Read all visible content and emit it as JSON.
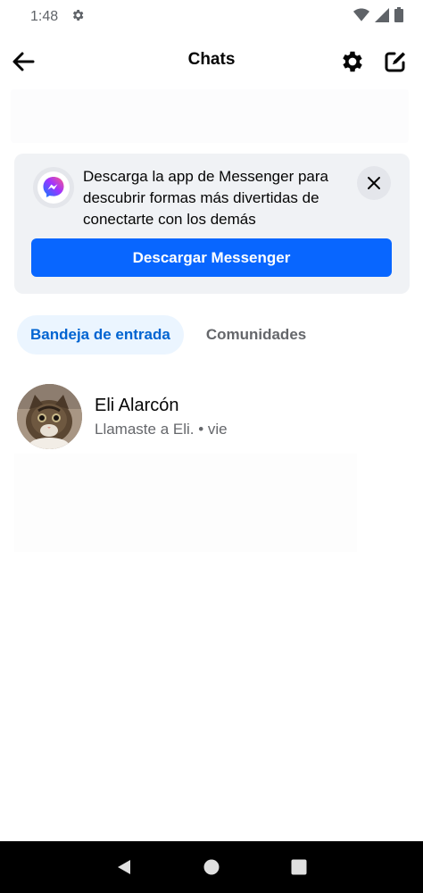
{
  "status_bar": {
    "time": "1:48",
    "icons": [
      "settings-gear-icon",
      "wifi-icon",
      "signal-icon",
      "battery-icon"
    ]
  },
  "app_bar": {
    "title": "Chats",
    "icons": [
      "back-arrow-icon",
      "settings-icon",
      "compose-icon"
    ]
  },
  "promo": {
    "text": "Descarga la app de Messenger para descubrir formas más divertidas de conectarte con los demás",
    "button_label": "Descargar Messenger",
    "icons": [
      "messenger-logo-icon",
      "close-icon"
    ],
    "accent_color": "#0866ff"
  },
  "tabs": [
    {
      "label": "Bandeja de entrada",
      "active": true
    },
    {
      "label": "Comunidades",
      "active": false
    }
  ],
  "chats": [
    {
      "name": "Eli Alarcón",
      "preview": "Llamaste a Eli. • vie",
      "avatar": "cat-photo-avatar"
    }
  ],
  "nav_bar": {
    "icons": [
      "back-triangle-icon",
      "home-circle-icon",
      "recents-square-icon"
    ]
  }
}
